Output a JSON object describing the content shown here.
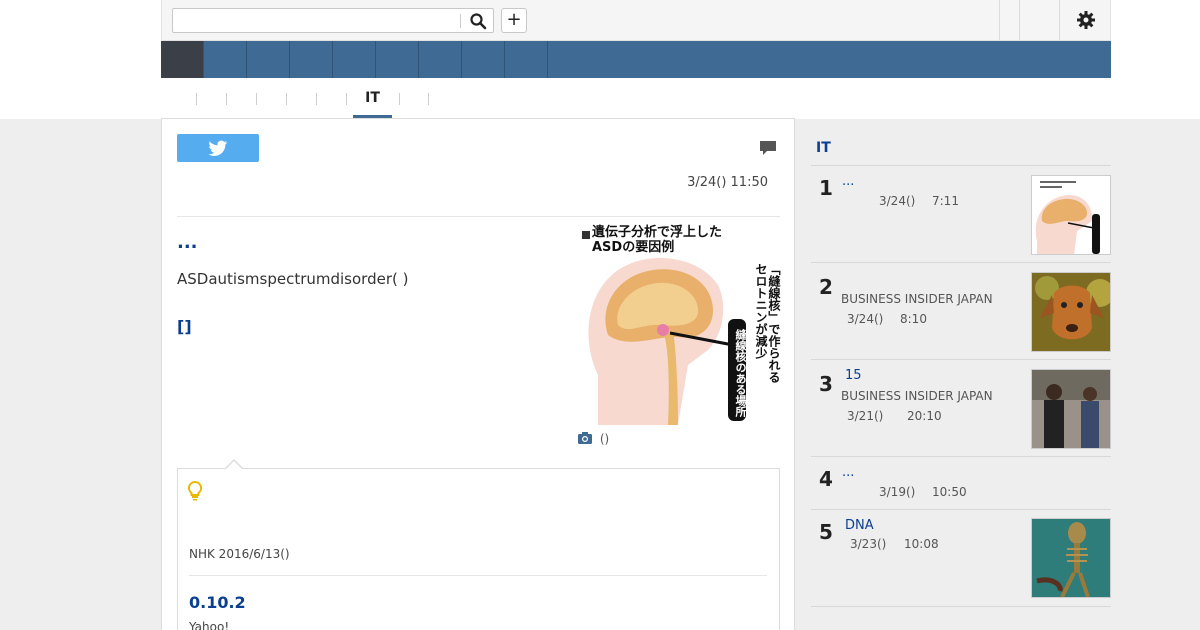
{
  "header": {
    "search_placeholder": "",
    "search_icon": "search-icon",
    "add_icon": "plus-icon",
    "add_label": "+",
    "settings_icon": "gear-icon"
  },
  "nav": {
    "active_index": 0,
    "colors": {
      "bar": "#3e6a94",
      "active": "#3b3f48"
    }
  },
  "subnav": {
    "active_tab": "IT"
  },
  "article": {
    "share_icon": "twitter-icon",
    "comment_icon": "comment-icon",
    "date": "3/24() 11:50",
    "title": "...",
    "lead": "ASDautismspectrumdisorder( )",
    "link": "[]",
    "figure": {
      "title_line1": "遺伝子分析で浮上した",
      "title_line2": "ASDの要因例",
      "vertical_text_1": "「縫線核」で作られる",
      "vertical_text_2": "セロトニンが減少",
      "label": "縫線核のある場所"
    },
    "photo_caption": "()",
    "photo_icon": "camera-icon"
  },
  "related": {
    "bulb_icon": "lightbulb-icon",
    "source": "NHK 2016/6/13()",
    "version": "0.10.2",
    "site": "Yahoo!"
  },
  "sidebar": {
    "heading": "IT",
    "ranking": [
      {
        "rank": "1",
        "title": "...",
        "source": "",
        "date": "3/24()",
        "time": "7:11",
        "thumb": "brain-diagram"
      },
      {
        "rank": "2",
        "title": "",
        "source": "BUSINESS INSIDER JAPAN",
        "date": "3/24()",
        "time": "8:10",
        "thumb": "dog-photo"
      },
      {
        "rank": "3",
        "title": "15",
        "source": "BUSINESS INSIDER JAPAN",
        "date": "3/21()",
        "time": "20:10",
        "thumb": "people-photo"
      },
      {
        "rank": "4",
        "title": "...",
        "source": "",
        "date": "3/19()",
        "time": "10:50",
        "thumb": ""
      },
      {
        "rank": "5",
        "title": "DNA",
        "source": "",
        "date": "3/23()",
        "time": "10:08",
        "thumb": "skeleton-photo"
      }
    ]
  }
}
